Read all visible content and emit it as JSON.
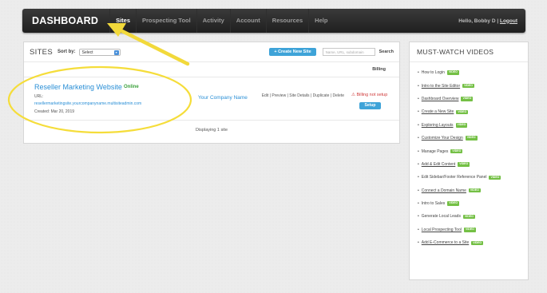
{
  "nav": {
    "brand": "DASHBOARD",
    "items": [
      {
        "label": "Sites",
        "active": true
      },
      {
        "label": "Prospecting Tool",
        "active": false
      },
      {
        "label": "Activity",
        "active": false
      },
      {
        "label": "Account",
        "active": false
      },
      {
        "label": "Resources",
        "active": false
      },
      {
        "label": "Help",
        "active": false
      }
    ],
    "greeting": "Hello, Bobby D |",
    "logout": "Logout"
  },
  "sites": {
    "title": "SITES",
    "sort_label": "Sort by:",
    "sort_value": "Select",
    "create_button": "+ Create New Site",
    "search_placeholder": "Name, URL, subdomain",
    "search_button": "Search",
    "billing_header": "Billing",
    "row": {
      "name": "Reseller Marketing Website",
      "status": "Online",
      "url_label": "URL:",
      "url": "resellermarketingsite.yourcompanyname.multisiteadmin.com",
      "created": "Created: Mar 20, 2019",
      "company": "Your Company Name",
      "actions": "Edit | Preview | Site Details | Duplicate | Delete",
      "billing_status": "Billing not setup",
      "setup_button": "Setup"
    },
    "displaying": "Displaying 1 site"
  },
  "videos": {
    "title": "MUST-WATCH VIDEOS",
    "badge": "VIDEO",
    "items": [
      {
        "label": "How to Login",
        "underlined": false
      },
      {
        "label": "Intro to the Site Editor",
        "underlined": true
      },
      {
        "label": "Dashboard Overview",
        "underlined": true
      },
      {
        "label": "Create a New Site",
        "underlined": true
      },
      {
        "label": "Exploring Layouts",
        "underlined": true
      },
      {
        "label": "Customize Your Design",
        "underlined": true
      },
      {
        "label": "Manage Pages",
        "underlined": false
      },
      {
        "label": "Add & Edit Content",
        "underlined": true
      },
      {
        "label": "Edit Sidebar/Footer Reference Panel",
        "underlined": false
      },
      {
        "label": "Connect a Domain Name",
        "underlined": true
      },
      {
        "label": "Intro to Sales",
        "underlined": false
      },
      {
        "label": "Generate Local Leads",
        "underlined": false
      },
      {
        "label": "Local Prospecting Tool",
        "underlined": true
      },
      {
        "label": "Add E-Commerce to a Site",
        "underlined": true
      }
    ]
  },
  "colors": {
    "accent_blue": "#3ea3d8",
    "link_blue": "#2a8fd6",
    "online_green": "#3aa03a",
    "badge_green": "#74c045",
    "warn_red": "#cf3a3a",
    "annotation_yellow": "#f5dd3a"
  },
  "icons": {
    "warning": "warning-triangle-icon",
    "sort_caret": "select-caret-icon",
    "bullet": "bullet-icon"
  }
}
